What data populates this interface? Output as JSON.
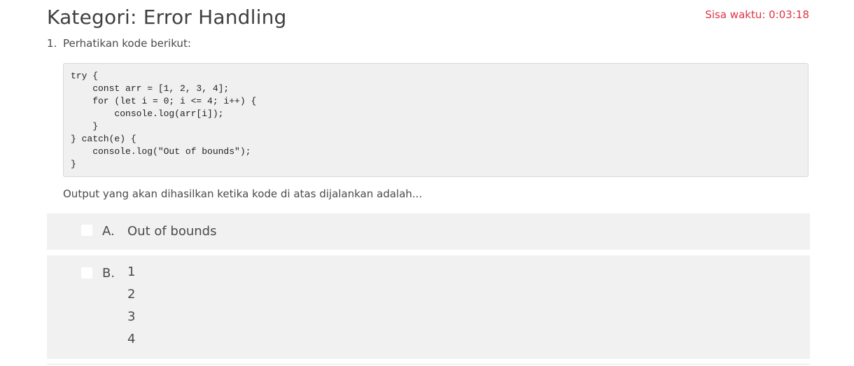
{
  "header": {
    "title": "Kategori: Error Handling",
    "timer": "Sisa waktu: 0:03:18"
  },
  "question": {
    "number": "1.",
    "text": "Perhatikan kode berikut:",
    "code": "try {\n    const arr = [1, 2, 3, 4];\n    for (let i = 0; i <= 4; i++) {\n        console.log(arr[i]);\n    }\n} catch(e) {\n    console.log(\"Out of bounds\");\n}",
    "prompt": "Output yang akan dihasilkan ketika kode di atas dijalankan adalah..."
  },
  "options": [
    {
      "letter": "A.",
      "text": "Out of bounds"
    },
    {
      "letter": "B.",
      "lines": [
        "1",
        "2",
        "3",
        "4"
      ]
    }
  ],
  "colors": {
    "timer": "#dc3545",
    "option_bg": "#f1f1f1",
    "code_bg": "#f0f0f0"
  }
}
